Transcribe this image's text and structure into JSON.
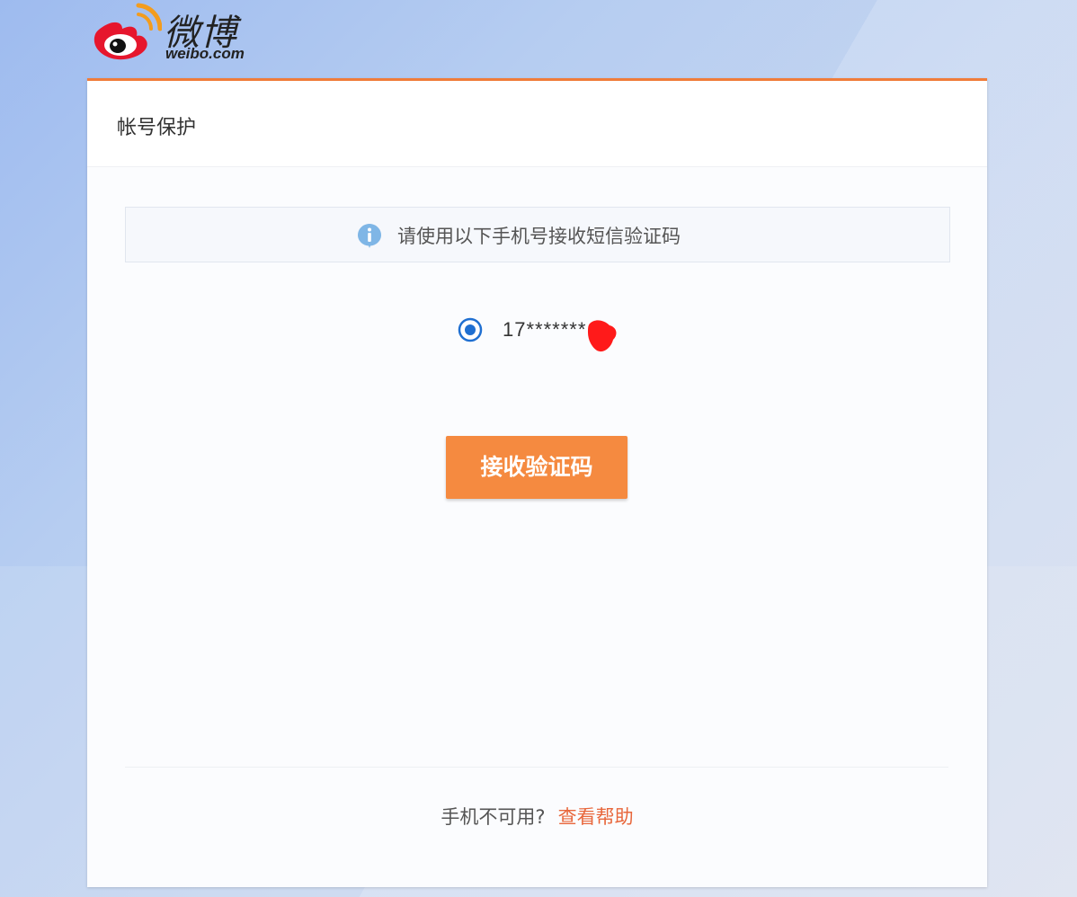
{
  "logo": {
    "name_cn": "微博",
    "name_en": "weibo.com"
  },
  "card": {
    "title": "帐号保护"
  },
  "notice": {
    "text": "请使用以下手机号接收短信验证码",
    "icon": "info-icon"
  },
  "phone_option": {
    "number": "17*******",
    "selected": true,
    "icon": "radio-selected-icon"
  },
  "button": {
    "label": "接收验证码"
  },
  "footer": {
    "question": "手机不可用?",
    "help_link": "查看帮助"
  },
  "colors": {
    "accent": "#f58a40",
    "top_border": "#f07c3a",
    "link": "#e8673c",
    "radio": "#1f6fd1"
  }
}
